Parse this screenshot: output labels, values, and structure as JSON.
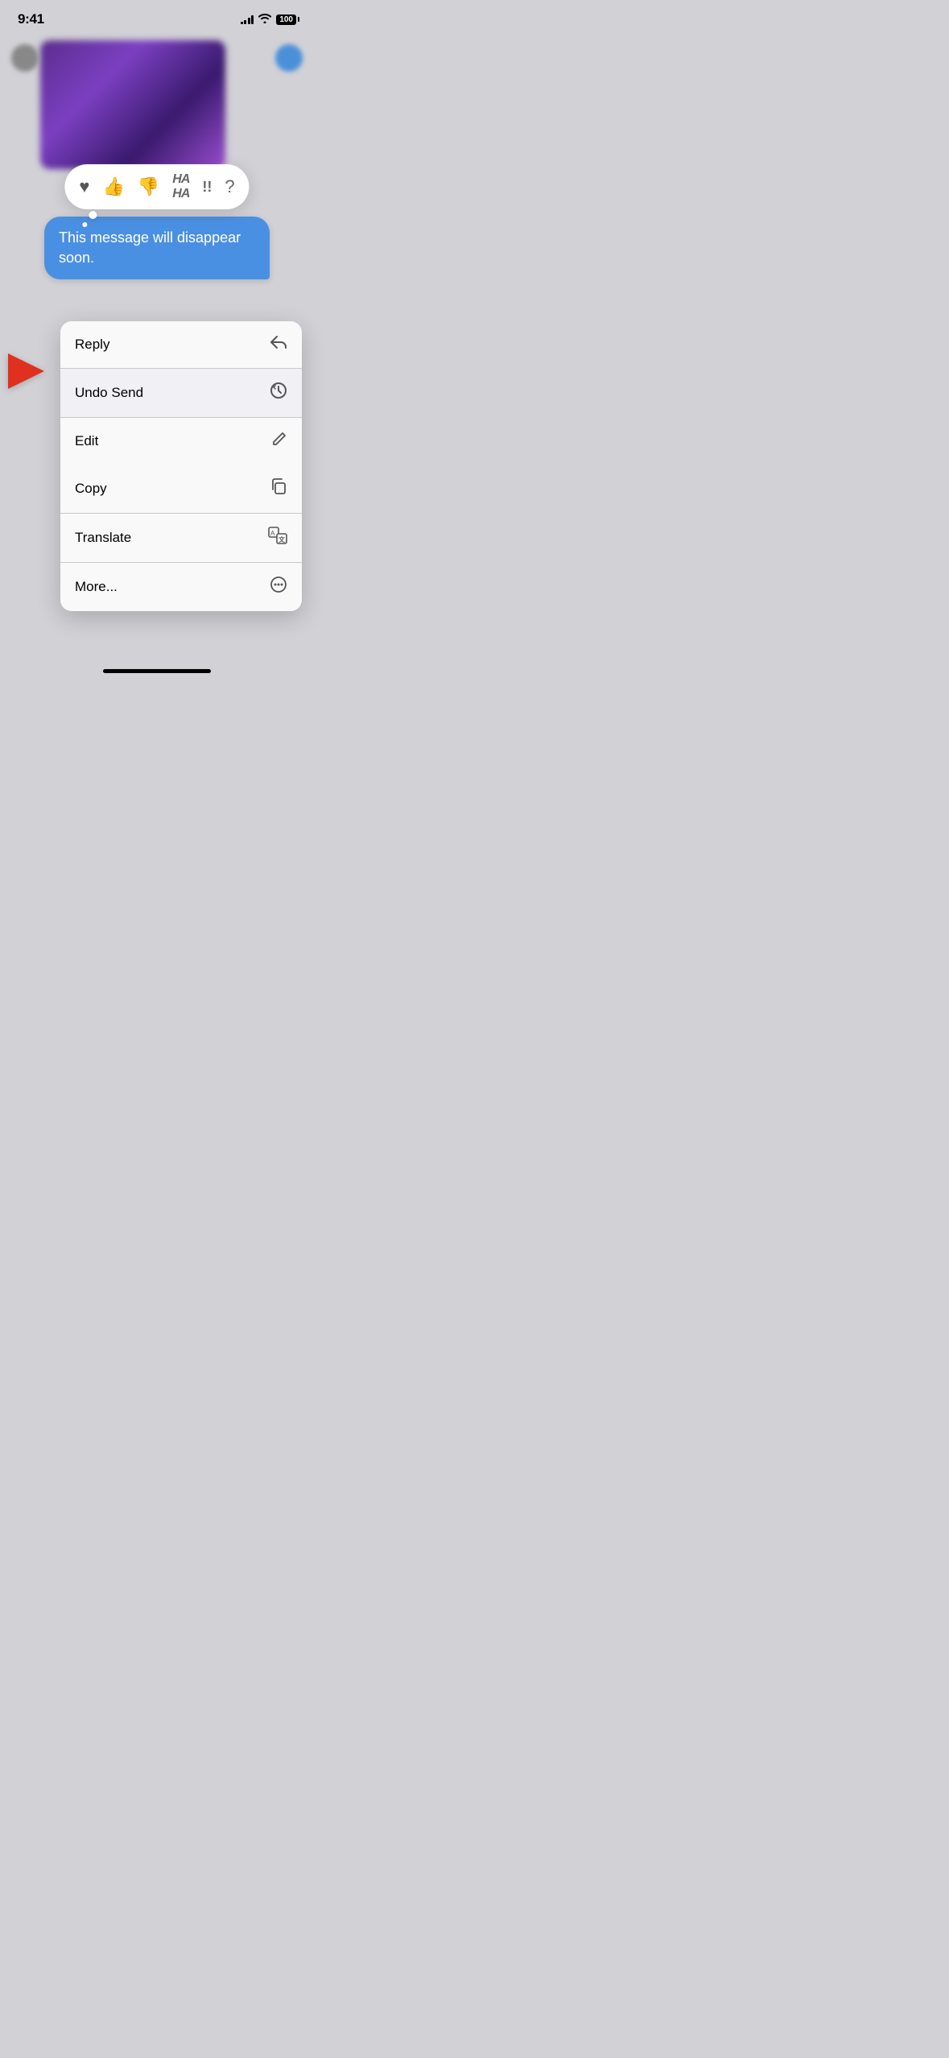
{
  "statusBar": {
    "time": "9:41",
    "battery": "100",
    "signalBars": [
      3,
      5,
      7,
      10,
      12
    ],
    "wifiSymbol": "wifi"
  },
  "reactionBar": {
    "reactions": [
      {
        "name": "heart",
        "emoji": "♥",
        "label": "heart"
      },
      {
        "name": "thumbs-up",
        "emoji": "👍",
        "label": "like"
      },
      {
        "name": "thumbs-down",
        "emoji": "👎",
        "label": "dislike"
      },
      {
        "name": "haha",
        "text": "HA\nHA",
        "label": "haha"
      },
      {
        "name": "exclaim",
        "text": "!!",
        "label": "emphasis"
      },
      {
        "name": "question",
        "text": "?",
        "label": "question"
      }
    ]
  },
  "messageBubble": {
    "text": "This message will disappear soon."
  },
  "contextMenu": {
    "groups": [
      {
        "items": [
          {
            "label": "Reply",
            "iconType": "reply"
          },
          {
            "label": "Undo Send",
            "iconType": "undo"
          },
          {
            "label": "Edit",
            "iconType": "edit"
          }
        ]
      },
      {
        "items": [
          {
            "label": "Copy",
            "iconType": "copy"
          },
          {
            "label": "Translate",
            "iconType": "translate"
          },
          {
            "label": "More...",
            "iconType": "more"
          }
        ]
      }
    ],
    "highlightedItem": "Undo Send"
  },
  "arrowLabel": "undo-send-arrow"
}
